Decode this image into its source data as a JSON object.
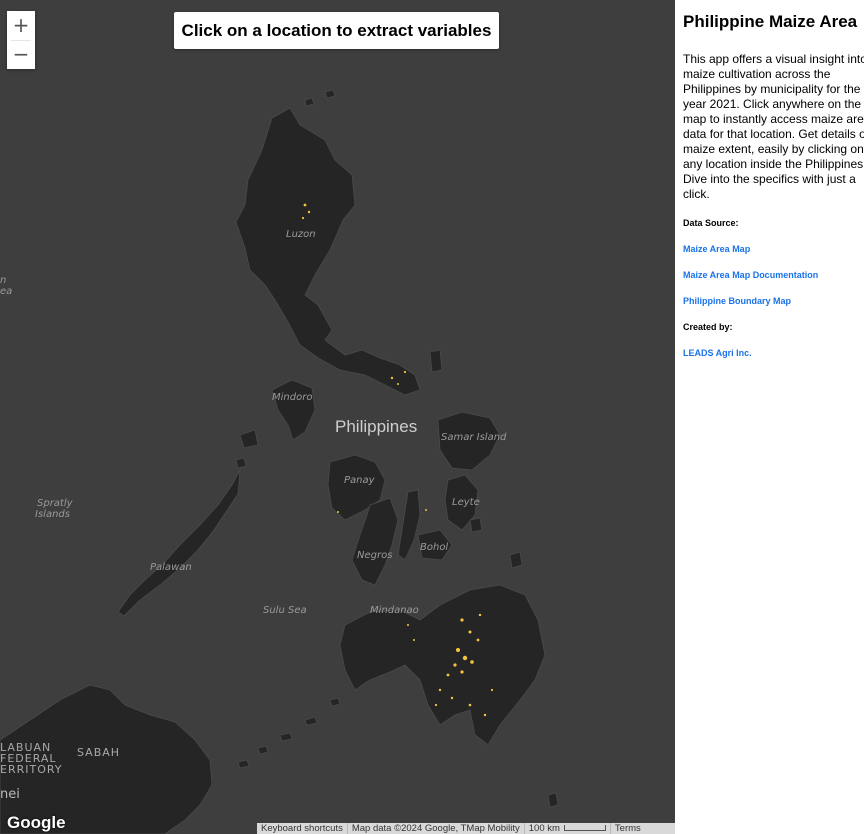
{
  "map": {
    "banner": "Click on a location to extract variables",
    "zoom_in": "+",
    "zoom_out": "−",
    "labels": {
      "luzon": "Luzon",
      "mindoro": "Mindoro",
      "philippines": "Philippines",
      "samar": "Samar Island",
      "panay": "Panay",
      "leyte": "Leyte",
      "negros": "Negros",
      "bohol": "Bohol",
      "palawan": "Palawan",
      "spratly_1": "Spratly",
      "spratly_2": "Islands",
      "sulu_sea": "Sulu Sea",
      "mindanao": "Mindanao",
      "sabah": "SABAH",
      "labuan_1": "LABUAN",
      "labuan_2": "FEDERAL",
      "labuan_3": "ERRITORY",
      "brunei": "nei",
      "edge_1": "n",
      "edge_2": "ea"
    },
    "logo": "Google",
    "attribution": {
      "shortcuts": "Keyboard shortcuts",
      "data": "Map data ©2024 Google, TMap Mobility",
      "scale": "100 km",
      "terms": "Terms"
    },
    "colors": {
      "water": "#3e3e3e",
      "land": "#252525",
      "maize": "#f5c542"
    }
  },
  "panel": {
    "title": "Philippine Maize Area",
    "description": "This app offers a visual insight into maize cultivation across the Philippines by municipality for the year 2021. Click anywhere on the map to instantly access maize area data for that location. Get details on maize extent, easily by clicking on any location inside the Philippines. Dive into the specifics with just a click.",
    "data_source_heading": "Data Source:",
    "links": [
      "Maize Area Map",
      "Maize Area Map Documentation",
      "Philippine Boundary Map"
    ],
    "created_by_heading": "Created by:",
    "creator": "LEADS Agri Inc."
  }
}
